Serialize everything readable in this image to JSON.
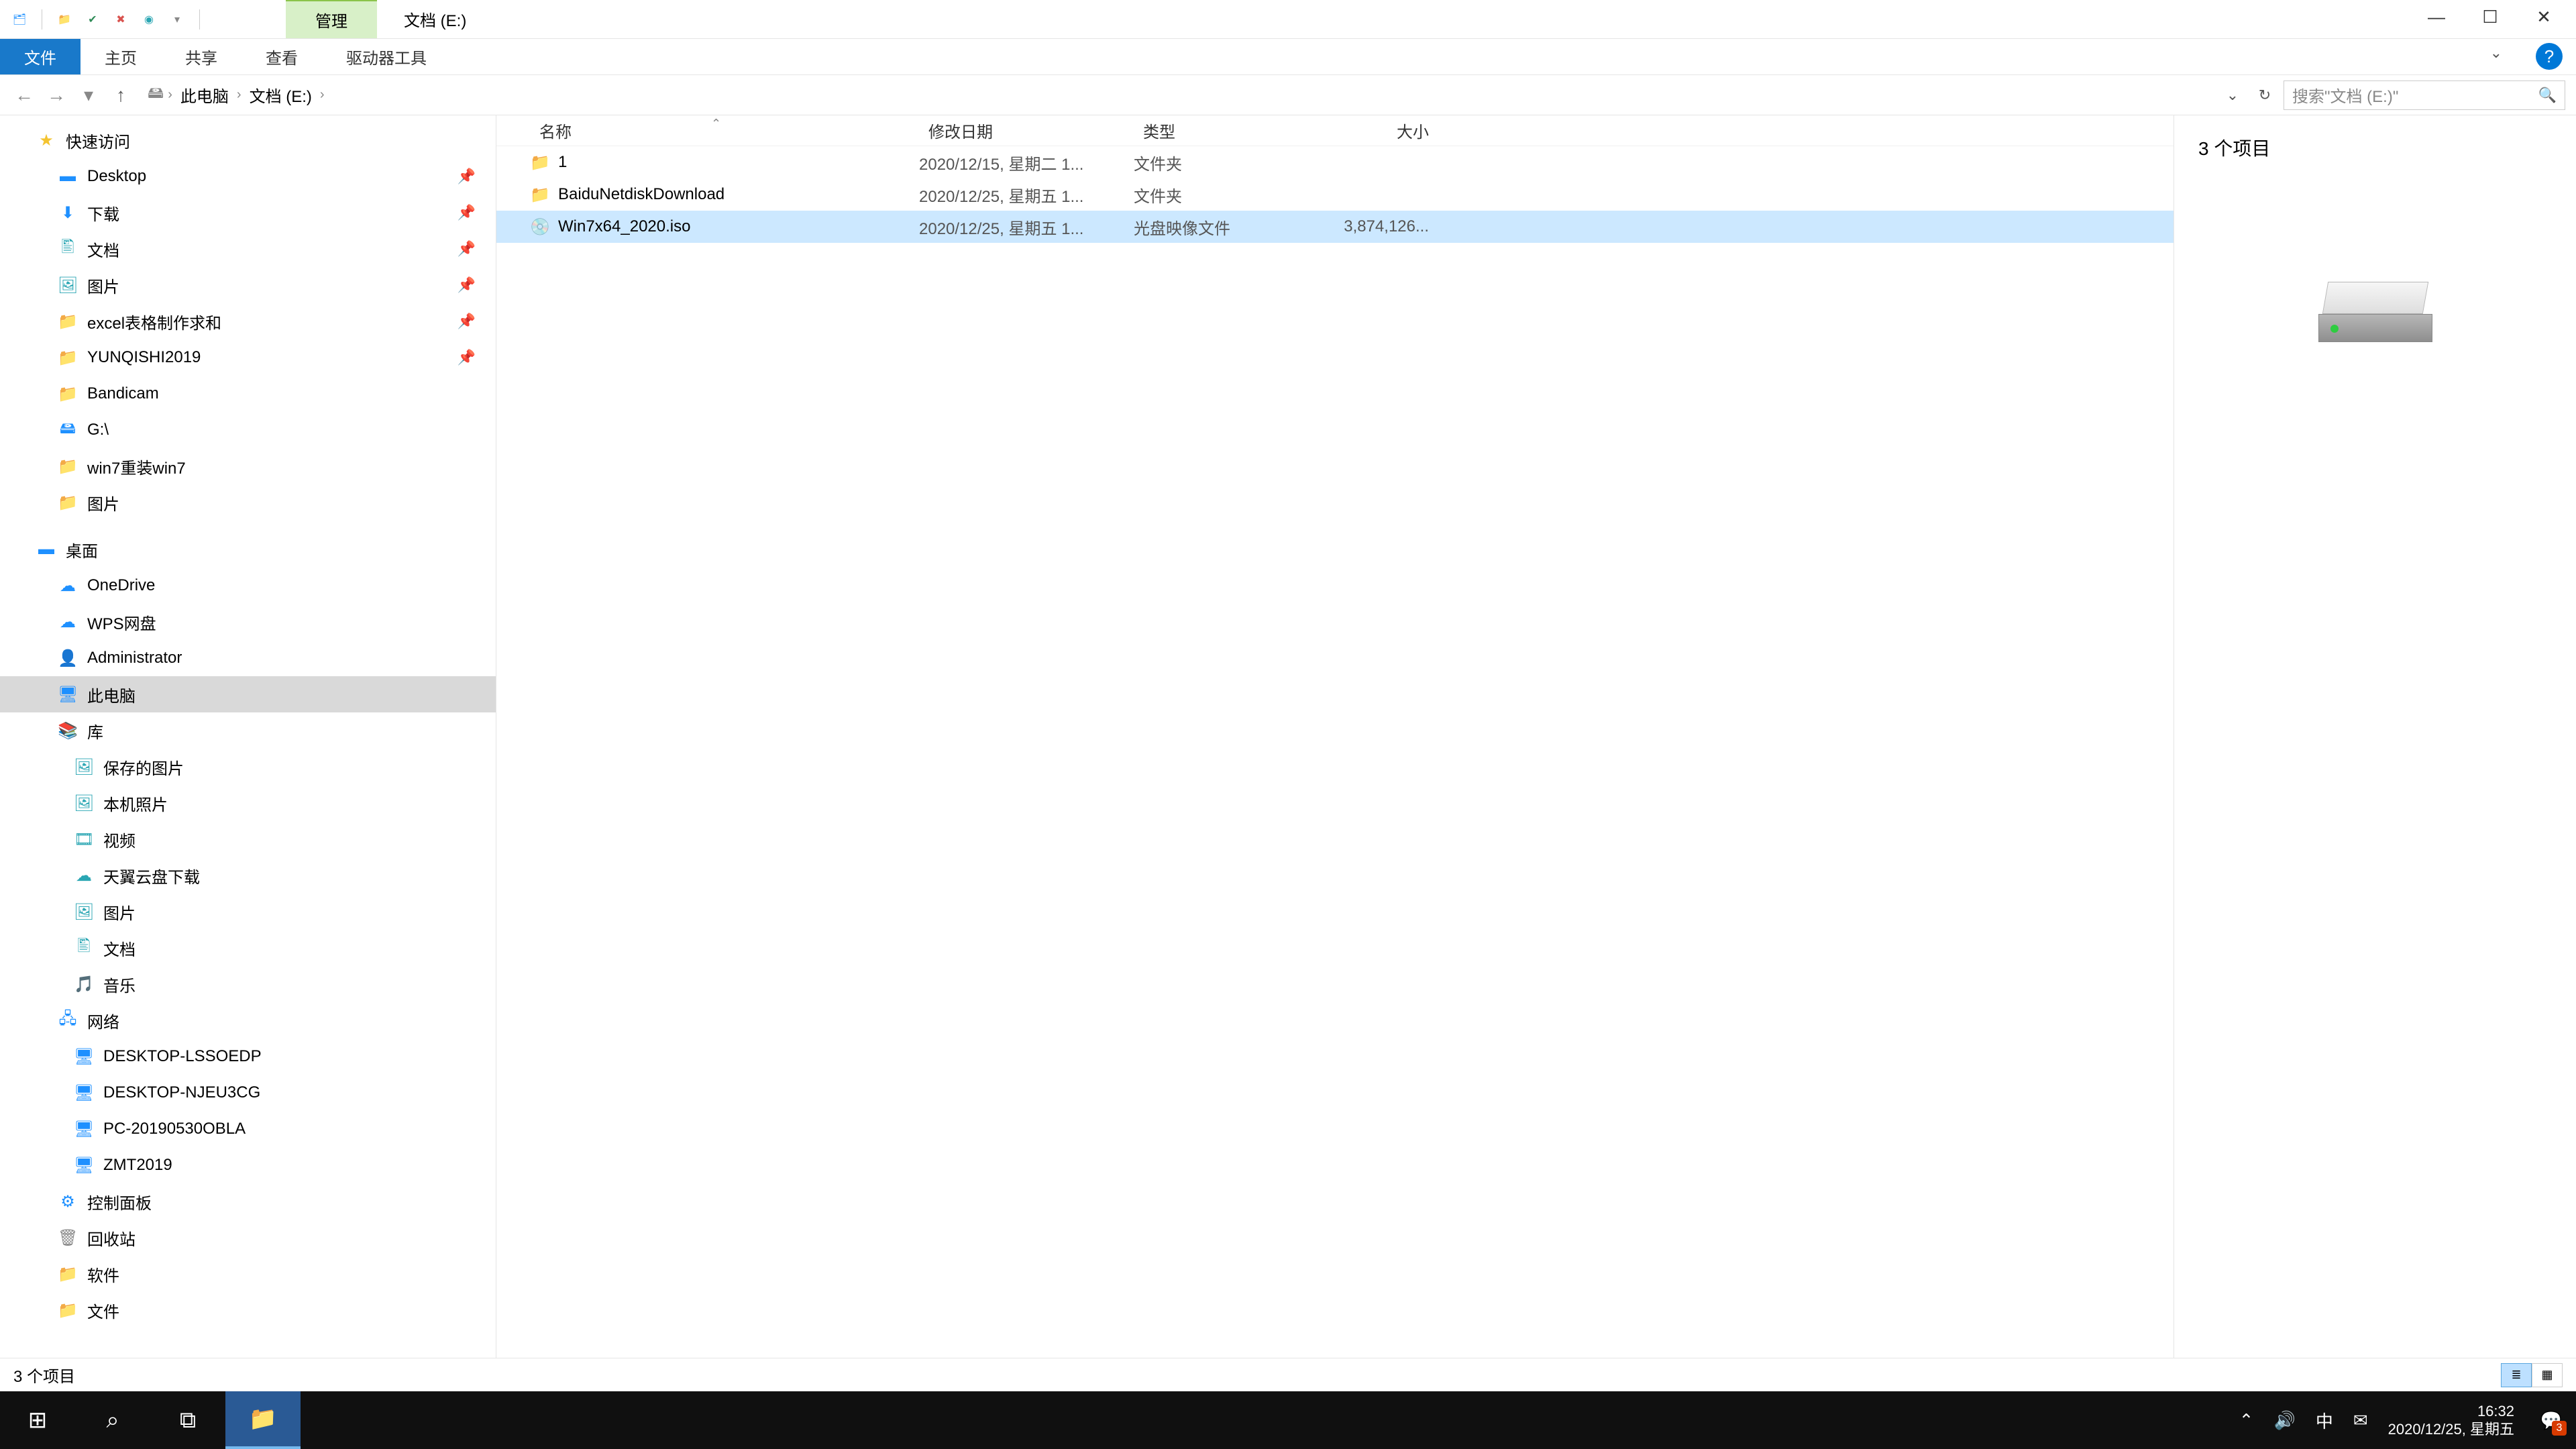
{
  "titlebar": {
    "context_tab": "管理",
    "window_title": "文档 (E:)"
  },
  "ribbon": {
    "file": "文件",
    "home": "主页",
    "share": "共享",
    "view": "查看",
    "drive_tools": "驱动器工具"
  },
  "breadcrumb": {
    "this_pc": "此电脑",
    "location": "文档 (E:)"
  },
  "search": {
    "placeholder": "搜索\"文档 (E:)\""
  },
  "columns": {
    "name": "名称",
    "date": "修改日期",
    "type": "类型",
    "size": "大小"
  },
  "files": [
    {
      "icon": "folder",
      "name": "1",
      "date": "2020/12/15, 星期二 1...",
      "type": "文件夹",
      "size": ""
    },
    {
      "icon": "folder",
      "name": "BaiduNetdiskDownload",
      "date": "2020/12/25, 星期五 1...",
      "type": "文件夹",
      "size": ""
    },
    {
      "icon": "iso",
      "name": "Win7x64_2020.iso",
      "date": "2020/12/25, 星期五 1...",
      "type": "光盘映像文件",
      "size": "3,874,126..."
    }
  ],
  "preview": {
    "title": "3 个项目"
  },
  "nav": {
    "quick_access": "快速访问",
    "desktop": "Desktop",
    "downloads": "下载",
    "documents": "文档",
    "pictures": "图片",
    "excel": "excel表格制作求和",
    "yunqishi": "YUNQISHI2019",
    "bandicam": "Bandicam",
    "gdrive": "G:\\",
    "win7": "win7重装win7",
    "pictures2": "图片",
    "desktop_cn": "桌面",
    "onedrive": "OneDrive",
    "wps": "WPS网盘",
    "admin": "Administrator",
    "this_pc": "此电脑",
    "library": "库",
    "saved_pics": "保存的图片",
    "camera_roll": "本机照片",
    "video": "视频",
    "tianyi": "天翼云盘下载",
    "pics3": "图片",
    "docs2": "文档",
    "music": "音乐",
    "network": "网络",
    "pc1": "DESKTOP-LSSOEDP",
    "pc2": "DESKTOP-NJEU3CG",
    "pc3": "PC-20190530OBLA",
    "pc4": "ZMT2019",
    "control": "控制面板",
    "recycle": "回收站",
    "software": "软件",
    "files": "文件"
  },
  "status": {
    "text": "3 个项目"
  },
  "systray": {
    "ime": "中",
    "time": "16:32",
    "date": "2020/12/25, 星期五",
    "notif_count": "3"
  }
}
